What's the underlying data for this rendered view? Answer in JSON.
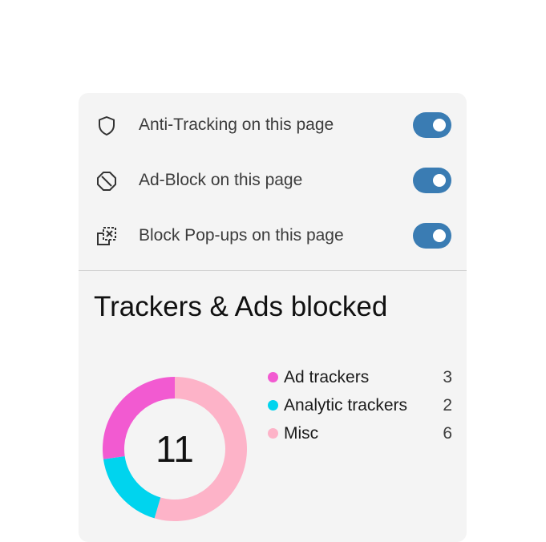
{
  "toggles": [
    {
      "icon": "shield-icon",
      "label": "Anti-Tracking on this page",
      "enabled": true
    },
    {
      "icon": "block-icon",
      "label": "Ad-Block on this page",
      "enabled": true
    },
    {
      "icon": "popup-block-icon",
      "label": "Block Pop-ups on this page",
      "enabled": true
    }
  ],
  "stats": {
    "title": "Trackers & Ads blocked",
    "total": "11"
  },
  "colors": {
    "toggle_on": "#3a7cb3",
    "ad_trackers": "#f25ad1",
    "analytic_trackers": "#00d4ee",
    "misc": "#fdb3c8"
  },
  "chart_data": {
    "type": "pie",
    "categories": [
      "Ad trackers",
      "Analytic trackers",
      "Misc"
    ],
    "values": [
      3,
      2,
      6
    ],
    "colors": [
      "#f25ad1",
      "#00d4ee",
      "#fdb3c8"
    ],
    "total": 11
  },
  "legend": [
    {
      "label": "Ad trackers",
      "count": "3"
    },
    {
      "label": "Analytic trackers",
      "count": "2"
    },
    {
      "label": "Misc",
      "count": "6"
    }
  ]
}
